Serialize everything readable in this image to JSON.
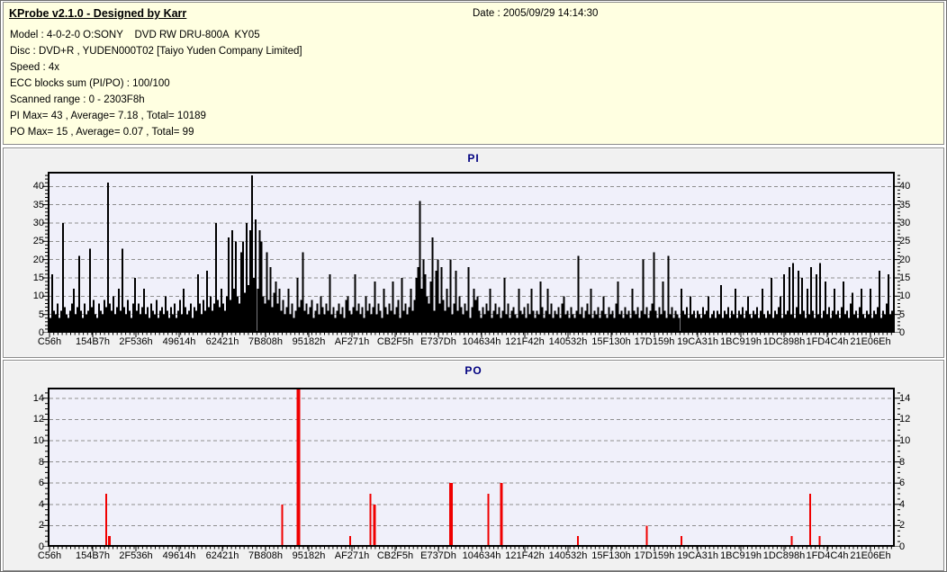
{
  "header": {
    "title": "KProbe v2.1.0 - Designed by Karr",
    "date": "Date : 2005/09/29 14:14:30",
    "lines": [
      "Model : 4-0-2-0 O:SONY    DVD RW DRU-800A  KY05",
      "Disc : DVD+R , YUDEN000T02 [Taiyo Yuden Company Limited]",
      "Speed : 4x",
      "ECC blocks sum (PI/PO) : 100/100",
      "Scanned range : 0 - 2303F8h",
      "PI Max= 43 , Average= 7.18 , Total= 10189",
      "PO Max= 15 , Average= 0.07 , Total= 99"
    ]
  },
  "colors": {
    "header_bg": "#FFFFE1",
    "panel_bg": "#F1F1F1",
    "plot_bg": "#F0F0FA",
    "grid": "#8f8f8f",
    "axis": "#000000",
    "title_text": "#000080",
    "pi_bar": "#000000",
    "po_bar": "#F00000"
  },
  "chart_data": [
    {
      "type": "bar",
      "title": "PI",
      "bar_color": "#000000",
      "ylim": [
        0,
        44
      ],
      "yticks": [
        0,
        5,
        10,
        15,
        20,
        25,
        30,
        35,
        40
      ],
      "stats": {
        "max": 43,
        "average": 7.18,
        "total": 10189
      },
      "x_labels": [
        "C56h",
        "154B7h",
        "2F536h",
        "49614h",
        "62421h",
        "7B808h",
        "95182h",
        "AF271h",
        "CB2F5h",
        "E737Dh",
        "104634h",
        "121F42h",
        "140532h",
        "15F130h",
        "17D159h",
        "19CA31h",
        "1BC919h",
        "1DC898h",
        "1FD4C4h",
        "21E06Eh"
      ],
      "values": [
        7,
        4,
        16,
        6,
        5,
        8,
        4,
        6,
        30,
        7,
        5,
        4,
        6,
        8,
        12,
        5,
        7,
        21,
        6,
        4,
        8,
        5,
        6,
        23,
        7,
        9,
        5,
        4,
        8,
        6,
        5,
        9,
        7,
        41,
        8,
        6,
        10,
        5,
        7,
        12,
        6,
        23,
        7,
        5,
        9,
        6,
        4,
        8,
        15,
        6,
        8,
        5,
        7,
        12,
        5,
        7,
        4,
        8,
        6,
        5,
        9,
        4,
        6,
        7,
        5,
        10,
        6,
        4,
        7,
        5,
        8,
        4,
        6,
        9,
        5,
        12,
        7,
        5,
        6,
        8,
        4,
        7,
        6,
        16,
        8,
        5,
        9,
        6,
        17,
        7,
        10,
        6,
        8,
        30,
        9,
        7,
        12,
        8,
        6,
        10,
        26,
        9,
        28,
        12,
        25,
        10,
        8,
        22,
        25,
        11,
        30,
        13,
        28,
        43,
        15,
        31,
        12,
        28,
        25,
        10,
        8,
        22,
        9,
        18,
        7,
        11,
        14,
        8,
        12,
        6,
        9,
        5,
        7,
        12,
        5,
        8,
        4,
        6,
        15,
        7,
        9,
        22,
        6,
        8,
        5,
        7,
        9,
        4,
        6,
        8,
        5,
        10,
        7,
        5,
        8,
        6,
        16,
        5,
        7,
        4,
        6,
        8,
        5,
        7,
        4,
        9,
        10,
        6,
        5,
        7,
        16,
        6,
        8,
        5,
        7,
        4,
        10,
        6,
        8,
        5,
        7,
        14,
        5,
        8,
        6,
        4,
        12,
        7,
        5,
        8,
        6,
        14,
        5,
        7,
        9,
        4,
        15,
        6,
        8,
        5,
        7,
        12,
        6,
        9,
        15,
        18,
        36,
        12,
        20,
        16,
        10,
        8,
        14,
        26,
        6,
        17,
        20,
        8,
        18,
        9,
        6,
        12,
        7,
        20,
        5,
        8,
        17,
        6,
        10,
        7,
        5,
        8,
        6,
        18,
        4,
        7,
        12,
        9,
        10,
        6,
        4,
        7,
        5,
        8,
        6,
        12,
        4,
        6,
        8,
        5,
        7,
        4,
        6,
        15,
        5,
        8,
        4,
        6,
        7,
        5,
        4,
        12,
        6,
        5,
        7,
        4,
        8,
        5,
        12,
        6,
        4,
        6,
        5,
        14,
        7,
        4,
        6,
        12,
        5,
        8,
        4,
        6,
        5,
        7,
        4,
        8,
        10,
        5,
        6,
        4,
        7,
        5,
        4,
        6,
        21,
        5,
        7,
        4,
        6,
        8,
        5,
        12,
        4,
        6,
        5,
        7,
        4,
        6,
        10,
        5,
        4,
        7,
        5,
        6,
        4,
        8,
        14,
        5,
        6,
        4,
        7,
        5,
        6,
        4,
        12,
        6,
        5,
        7,
        4,
        6,
        20,
        5,
        7,
        4,
        6,
        8,
        22,
        6,
        4,
        7,
        5,
        14,
        6,
        4,
        21,
        5,
        7,
        4,
        6,
        5,
        4,
        12,
        6,
        5,
        7,
        4,
        10,
        5,
        6,
        4,
        6,
        5,
        4,
        7,
        5,
        6,
        10,
        4,
        5,
        6,
        4,
        6,
        5,
        13,
        4,
        6,
        5,
        7,
        4,
        6,
        5,
        12,
        4,
        6,
        5,
        7,
        4,
        6,
        10,
        5,
        4,
        6,
        5,
        7,
        4,
        6,
        12,
        5,
        4,
        6,
        5,
        15,
        4,
        6,
        5,
        7,
        10,
        4,
        16,
        5,
        6,
        18,
        5,
        19,
        4,
        7,
        17,
        5,
        15,
        6,
        4,
        12,
        5,
        18,
        6,
        4,
        16,
        5,
        19,
        4,
        6,
        14,
        5,
        7,
        4,
        6,
        12,
        5,
        6,
        4,
        7,
        14,
        5,
        6,
        4,
        8,
        11,
        5,
        6,
        4,
        7,
        12,
        5,
        4,
        6,
        5,
        12,
        4,
        6,
        5,
        7,
        17,
        4,
        6,
        5,
        8,
        16,
        5,
        6,
        9
      ]
    },
    {
      "type": "bar",
      "title": "PO",
      "bar_color": "#F00000",
      "ylim": [
        0,
        15
      ],
      "yticks": [
        0,
        2,
        4,
        6,
        8,
        10,
        12,
        14
      ],
      "stats": {
        "max": 15,
        "average": 0.07,
        "total": 99
      },
      "x_labels": [
        "C56h",
        "154B7h",
        "2F536h",
        "49614h",
        "62421h",
        "7B808h",
        "95182h",
        "AF271h",
        "CB2F5h",
        "E737Dh",
        "104634h",
        "121F42h",
        "140532h",
        "15F130h",
        "17D159h",
        "19CA31h",
        "1BC919h",
        "1DC898h",
        "1FD4C4h",
        "21E06Eh"
      ],
      "spikes": [
        [
          0.068,
          5,
          2
        ],
        [
          0.071,
          1,
          3
        ],
        [
          0.276,
          4,
          2
        ],
        [
          0.294,
          15,
          4
        ],
        [
          0.356,
          1,
          2
        ],
        [
          0.38,
          5,
          2
        ],
        [
          0.384,
          4,
          3
        ],
        [
          0.474,
          6,
          4
        ],
        [
          0.519,
          5,
          2
        ],
        [
          0.534,
          6,
          3
        ],
        [
          0.625,
          1,
          2
        ],
        [
          0.706,
          2,
          2
        ],
        [
          0.747,
          1,
          2
        ],
        [
          0.877,
          1,
          2
        ],
        [
          0.899,
          5,
          2
        ],
        [
          0.91,
          1,
          2
        ]
      ]
    }
  ]
}
